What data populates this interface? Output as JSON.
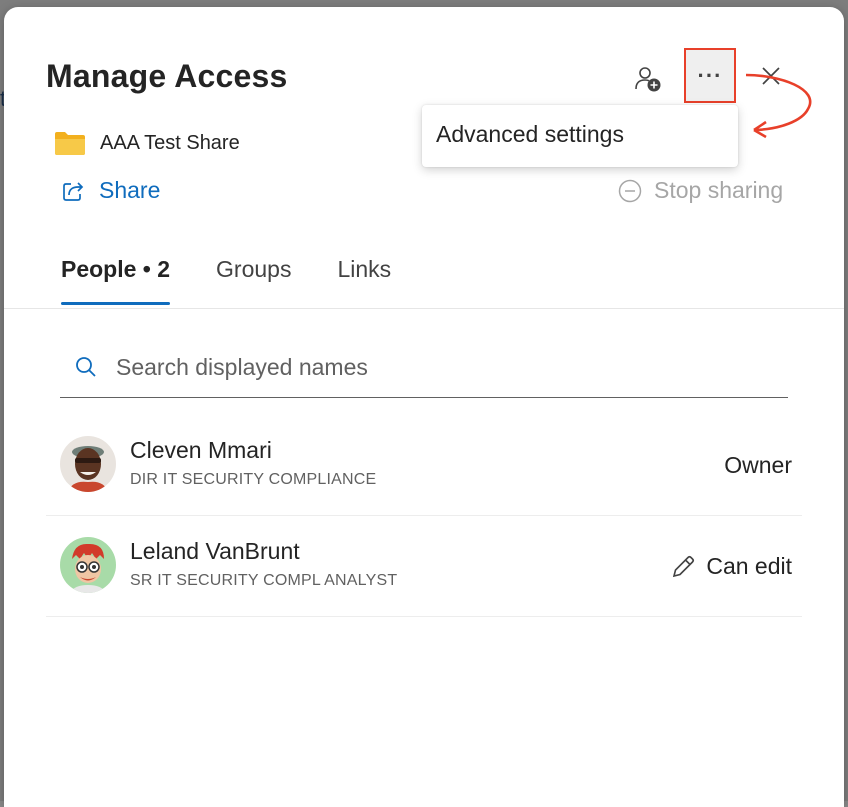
{
  "backdrop": {
    "glyph": "t"
  },
  "dialog": {
    "title": "Manage Access",
    "icons": {
      "add_person": "add-person-icon",
      "more": "more-options-icon",
      "close": "close-icon"
    },
    "more_label": "···"
  },
  "menu": {
    "items": [
      {
        "label": "Advanced settings"
      }
    ]
  },
  "item": {
    "icon": "folder-icon",
    "name": "AAA Test Share"
  },
  "actions": {
    "share": "Share",
    "stop_sharing": "Stop sharing"
  },
  "tabs": [
    {
      "label": "People • 2",
      "active": true
    },
    {
      "label": "Groups",
      "active": false
    },
    {
      "label": "Links",
      "active": false
    }
  ],
  "search": {
    "placeholder": "Search displayed names",
    "value": ""
  },
  "people": [
    {
      "name": "Cleven Mmari",
      "title": "DIR IT SECURITY COMPLIANCE",
      "permission": "Owner",
      "permission_icon": ""
    },
    {
      "name": "Leland VanBrunt",
      "title": "SR IT SECURITY COMPL ANALYST",
      "permission": "Can edit",
      "permission_icon": "pencil-icon"
    }
  ],
  "colors": {
    "accent": "#0f6cbd",
    "annotation": "#e8402a",
    "folder": "#f7c948",
    "disabled_text": "#a6a6a6"
  }
}
